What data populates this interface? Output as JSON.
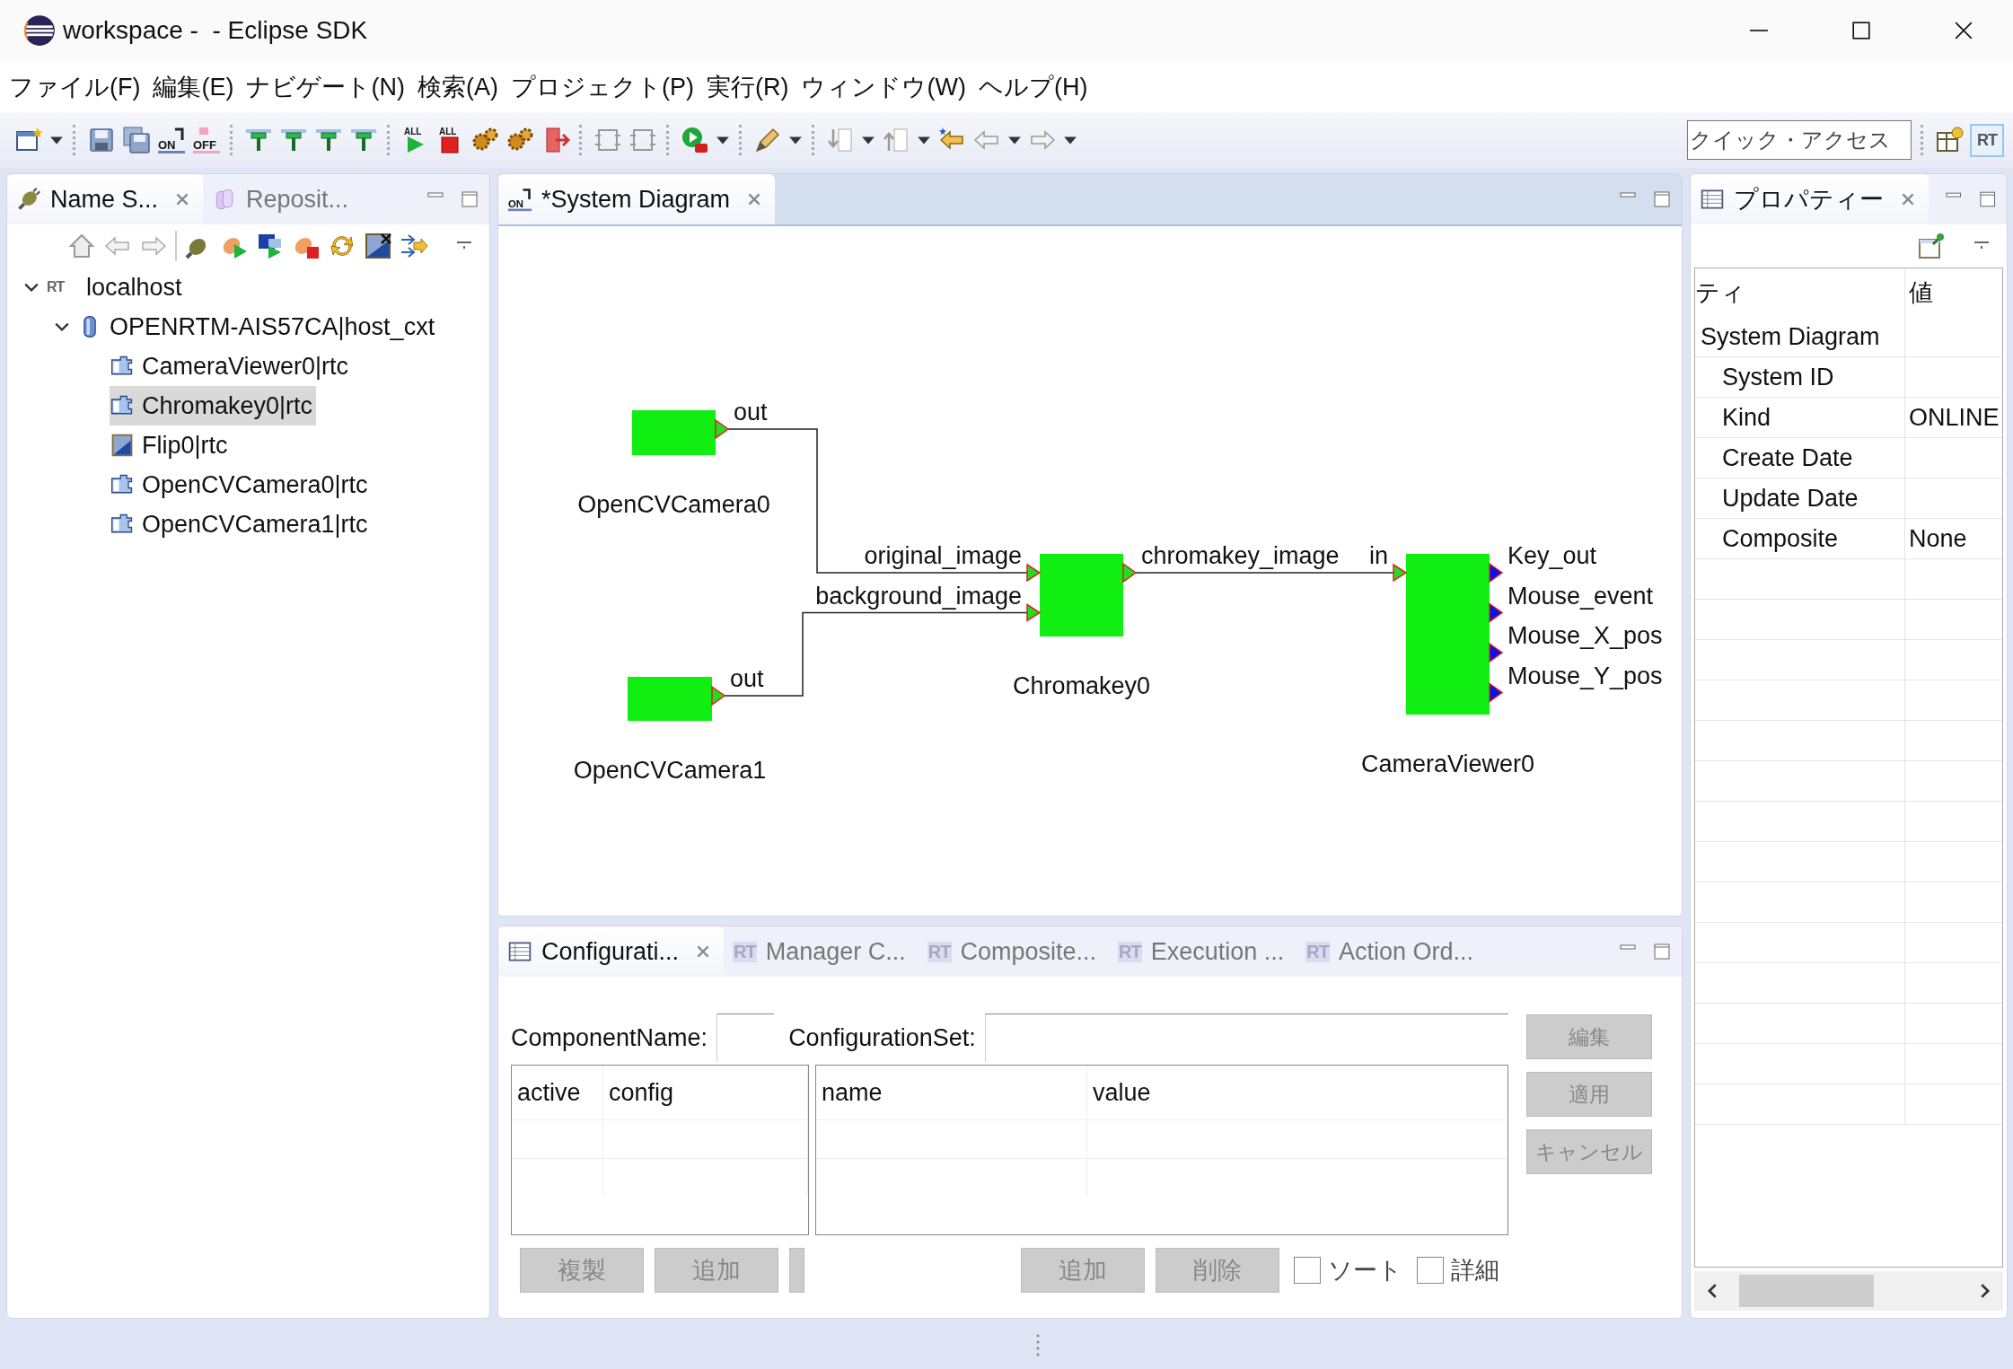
{
  "window": {
    "title": "workspace -  - Eclipse SDK"
  },
  "menu": [
    "ファイル(F)",
    "編集(E)",
    "ナビゲート(N)",
    "検索(A)",
    "プロジェクト(P)",
    "実行(R)",
    "ウィンドウ(W)",
    "ヘルプ(H)"
  ],
  "toolbar": {
    "icon_texts": [
      "ON",
      "OFF",
      "ALL",
      "ALL"
    ],
    "quick_access": {
      "placeholder": "クイック・アクセス"
    },
    "perspective": {
      "icon_text": "RT",
      "selected": true
    }
  },
  "left_panel": {
    "tabs": [
      {
        "label": "Name S...",
        "selected": true,
        "closable": true
      },
      {
        "label": "Reposit...",
        "selected": false,
        "closable": false
      }
    ],
    "tree": [
      {
        "label": "localhost",
        "kind": "host",
        "icon_text": "RT",
        "expanded": true,
        "selected": false,
        "children": [
          {
            "label": "OPENRTM-AIS57CA|host_cxt",
            "kind": "context",
            "expanded": true,
            "selected": false,
            "children": [
              {
                "label": "CameraViewer0|rtc",
                "kind": "rtc",
                "selected": false
              },
              {
                "label": "Chromakey0|rtc",
                "kind": "rtc",
                "selected": true
              },
              {
                "label": "Flip0|rtc",
                "kind": "image",
                "selected": false
              },
              {
                "label": "OpenCVCamera0|rtc",
                "kind": "rtc",
                "selected": false
              },
              {
                "label": "OpenCVCamera1|rtc",
                "kind": "rtc",
                "selected": false
              }
            ]
          }
        ]
      }
    ]
  },
  "editor": {
    "tabs": [
      {
        "label": "*System Diagram",
        "icon_text": "ON",
        "selected": true
      }
    ],
    "components": [
      {
        "name": "OpenCVCamera0",
        "ports": [
          {
            "label": "out",
            "kind": "out"
          }
        ]
      },
      {
        "name": "OpenCVCamera1",
        "ports": [
          {
            "label": "out",
            "kind": "out"
          }
        ]
      },
      {
        "name": "Chromakey0",
        "ports": [
          {
            "label": "original_image",
            "kind": "in"
          },
          {
            "label": "background_image",
            "kind": "in"
          },
          {
            "label": "chromakey_image",
            "kind": "out"
          }
        ]
      },
      {
        "name": "CameraViewer0",
        "ports": [
          {
            "label": "in",
            "kind": "in"
          },
          {
            "label": "Key_out",
            "kind": "event"
          },
          {
            "label": "Mouse_event",
            "kind": "event"
          },
          {
            "label": "Mouse_X_pos",
            "kind": "event"
          },
          {
            "label": "Mouse_Y_pos",
            "kind": "event"
          }
        ]
      }
    ]
  },
  "bottom_panel": {
    "tabs": [
      {
        "label": "Configurati...",
        "selected": true,
        "closable": true
      },
      {
        "label": "Manager C...",
        "icon_text": "RT",
        "selected": false,
        "closable": false
      },
      {
        "label": "Composite...",
        "icon_text": "RT",
        "selected": false,
        "closable": false
      },
      {
        "label": "Execution ...",
        "icon_text": "RT",
        "selected": false,
        "closable": false
      },
      {
        "label": "Action Ord...",
        "icon_text": "RT",
        "selected": false,
        "closable": false
      }
    ],
    "component_name_label": "ComponentName:",
    "configuration_set_label": "ConfigurationSet:",
    "config_columns": [
      "active",
      "config"
    ],
    "param_columns": [
      "name",
      "value"
    ],
    "side_buttons": [
      {
        "label": "編集",
        "disabled": true
      },
      {
        "label": "適用",
        "disabled": true
      },
      {
        "label": "キャンセル",
        "disabled": true
      }
    ],
    "left_buttons": [
      {
        "label": "複製",
        "disabled": true
      },
      {
        "label": "追加",
        "disabled": true
      }
    ],
    "right_buttons": [
      {
        "label": "追加",
        "disabled": true
      },
      {
        "label": "削除",
        "disabled": true
      }
    ],
    "checkboxes": [
      {
        "label": "ソート",
        "checked": false
      },
      {
        "label": "詳細",
        "checked": false
      }
    ]
  },
  "properties": {
    "tabs": [
      {
        "label": "プロパティー",
        "selected": true,
        "closable": true
      }
    ],
    "columns": [
      "ティ",
      "値"
    ],
    "rows": [
      {
        "property": "System Diagram",
        "children": [
          {
            "property": "System ID"
          },
          {
            "property": "Kind",
            "value": "ONLINE"
          },
          {
            "property": "Create Date"
          },
          {
            "property": "Update Date"
          },
          {
            "property": "Composite",
            "value": "None"
          }
        ]
      }
    ]
  }
}
